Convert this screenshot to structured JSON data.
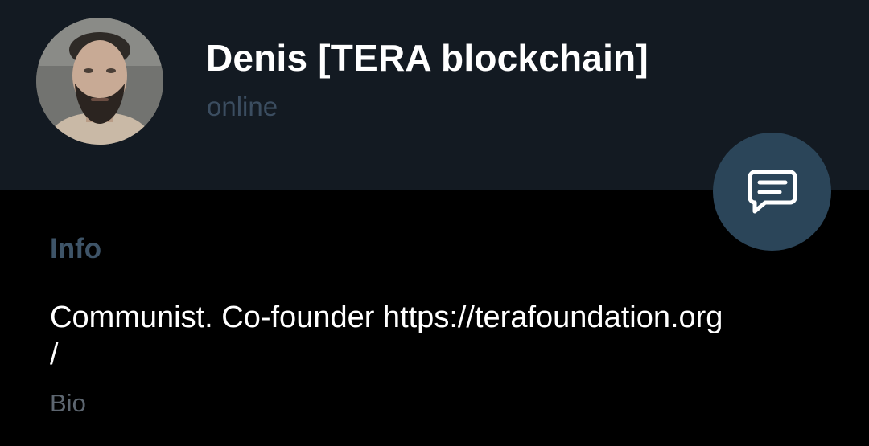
{
  "profile": {
    "name": "Denis [TERA blockchain]",
    "status": "online",
    "avatar_icon": "person-photo"
  },
  "fab": {
    "icon": "message-icon"
  },
  "info": {
    "section_title": "Info",
    "bio_line1": "Communist. Co-founder https://terafoundation.org",
    "bio_line2": "/",
    "bio_label": "Bio"
  },
  "colors": {
    "header_bg": "#131a22",
    "body_bg": "#000000",
    "fab_bg": "#2b4559",
    "muted_blue": "#3e5468",
    "muted_gray": "#5d6670"
  }
}
